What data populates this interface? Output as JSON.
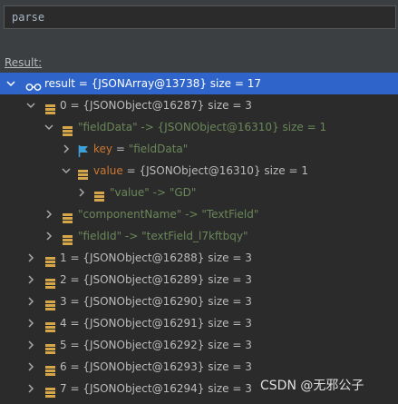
{
  "expression": {
    "value": "parse"
  },
  "result_label": "Result:",
  "root": {
    "label": "result = {JSONArray@13738}  size = 17"
  },
  "nodes": [
    {
      "label": "0 = {JSONObject@16287}  size = 3"
    },
    {
      "label": "\"fieldData\" -> {JSONObject@16310}  size = 1"
    },
    {
      "name": "key",
      "eq": " = ",
      "value": "\"fieldData\""
    },
    {
      "name": "value",
      "eq": " = ",
      "value": "{JSONObject@16310}  size = 1"
    },
    {
      "label": "\"value\" -> \"GD\""
    },
    {
      "label": "\"componentName\" -> \"TextField\""
    },
    {
      "label": "\"fieldId\" -> \"textField_l7kftbqy\""
    },
    {
      "label": "1 = {JSONObject@16288}  size = 3"
    },
    {
      "label": "2 = {JSONObject@16289}  size = 3"
    },
    {
      "label": "3 = {JSONObject@16290}  size = 3"
    },
    {
      "label": "4 = {JSONObject@16291}  size = 3"
    },
    {
      "label": "5 = {JSONObject@16292}  size = 3"
    },
    {
      "label": "6 = {JSONObject@16293}  size = 3"
    },
    {
      "label": "7 = {JSONObject@16294}  size = 3"
    }
  ],
  "watermark": "CSDN @无邪公子"
}
